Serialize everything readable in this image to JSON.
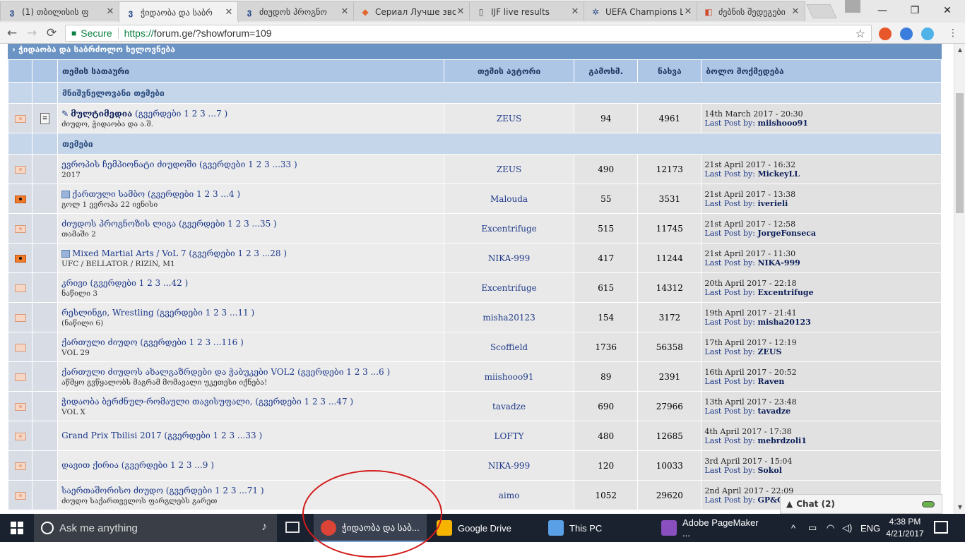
{
  "browser": {
    "tabs": [
      {
        "icon": "ვ",
        "icon_color": "#2b4c8c",
        "title": "(1) თბილისის ფ",
        "close": "✕"
      },
      {
        "icon": "ვ",
        "icon_color": "#2b4c8c",
        "title": "ჭიდაობა და საბრ",
        "close": "✕"
      },
      {
        "icon": "ვ",
        "icon_color": "#2b4c8c",
        "title": "ძიუდოს პროგნო",
        "close": "✕"
      },
      {
        "icon": "◆",
        "icon_color": "#e2672b",
        "title": "Сериал Лучше зво",
        "close": "✕"
      },
      {
        "icon": "▯",
        "icon_color": "#555555",
        "title": "IJF live results",
        "close": "✕"
      },
      {
        "icon": "✲",
        "icon_color": "#2b4c8c",
        "title": "UEFA Champions L",
        "close": "✕"
      },
      {
        "icon": "◧",
        "icon_color": "#d14b2c",
        "title": "ძებნის შედეგები",
        "close": "✕"
      }
    ],
    "window_controls": {
      "minimize": "—",
      "maximize": "❐",
      "close": "✕"
    },
    "nav": {
      "back": "←",
      "forward": "→",
      "reload": "⟳"
    },
    "address": {
      "lock": "🔒",
      "secure_label": "Secure",
      "proto": "https://",
      "rest": "forum.ge/?showforum=109",
      "star": "☆"
    }
  },
  "forum": {
    "heading": "› ჭიდაობა და საბრძოლო ხელოვნება",
    "columns": {
      "title": "თემის სათაური",
      "author": "თემის ავტორი",
      "replies": "გამოხმ.",
      "views": "ნახვა",
      "last": "ბოლო მოქმედება"
    },
    "pinned_section": "მნიშვნელოვანი თემები",
    "topics_section": "თემები",
    "last_post_label": "Last Post by:",
    "pinned": [
      {
        "title": "მულტიმედია",
        "pages": "(გვერდები 1 2 3 ...7 )",
        "desc": "ძიუდო, ჭიდაობა და ა.შ.",
        "author": "ZEUS",
        "replies": "94",
        "views": "4961",
        "date": "14th March 2017 - 20:30",
        "last_by": "miishooo91"
      }
    ],
    "topics": [
      {
        "title": "ევროპის ჩემპიონატი ძიუდოში",
        "pages": "(გვერდები 1 2 3 ...33 )",
        "desc": "2017",
        "author": "ZEUS",
        "replies": "490",
        "views": "12173",
        "date": "21st April 2017 - 16:32",
        "last_by": "MickeyLL",
        "icon": "normal"
      },
      {
        "title": "ქართული სამბო",
        "pages": "(გვერდები 1 2 3 ...4 )",
        "desc": "გოლ 1 ევროპა 22 ივნისი",
        "author": "Malouda",
        "replies": "55",
        "views": "3531",
        "date": "21st April 2017 - 13:38",
        "last_by": "iverieli",
        "icon": "hot"
      },
      {
        "title": "ძიუდოს პროგნოზის ლიგა",
        "pages": "(გვერდები 1 2 3 ...35 )",
        "desc": "თამაში 2",
        "author": "Excentrifuge",
        "replies": "515",
        "views": "11745",
        "date": "21st April 2017 - 12:58",
        "last_by": "JorgeFonseca",
        "icon": "normal"
      },
      {
        "title": "Mixed Martial Arts / VoL 7",
        "pages": "(გვერდები 1 2 3 ...28 )",
        "desc": "UFC / BELLATOR / RIZIN, M1",
        "author": "NIKA-999",
        "replies": "417",
        "views": "11244",
        "date": "21st April 2017 - 11:30",
        "last_by": "NIKA-999",
        "icon": "hot"
      },
      {
        "title": "კრივი",
        "pages": "(გვერდები 1 2 3 ...42 )",
        "desc": "ნაწილი 3",
        "author": "Excentrifuge",
        "replies": "615",
        "views": "14312",
        "date": "20th April 2017 - 22:18",
        "last_by": "Excentrifuge",
        "icon": "plain"
      },
      {
        "title": "რესლინგი, Wrestling",
        "pages": "(გვერდები 1 2 3 ...11 )",
        "desc": "(ნაწილი 6)",
        "author": "misha20123",
        "replies": "154",
        "views": "3172",
        "date": "19th April 2017 - 21:41",
        "last_by": "misha20123",
        "icon": "plain"
      },
      {
        "title": "ქართული ძიუდო",
        "pages": "(გვერდები 1 2 3 ...116 )",
        "desc": "VOL 29",
        "author": "Scoffield",
        "replies": "1736",
        "views": "56358",
        "date": "17th April 2017 - 12:19",
        "last_by": "ZEUS",
        "icon": "plain"
      },
      {
        "title": "ქართული ძიუდოს ახალგაზრდები და ჭაბუკები VOL2",
        "pages": "(გვერდები 1 2 3 ...6 )",
        "desc": "აწმყო გვწყალობს მაგრამ მომავალი უკეთესი იქნება!",
        "author": "miishooo91",
        "replies": "89",
        "views": "2391",
        "date": "16th April 2017 - 20:52",
        "last_by": "Raven",
        "icon": "plain"
      },
      {
        "title": "ჭიდაობა ბერძნულ-რომაული თავისუფალი,",
        "pages": "(გვერდები 1 2 3 ...47 )",
        "desc": "VOL X",
        "author": "tavadze",
        "replies": "690",
        "views": "27966",
        "date": "13th April 2017 - 23:48",
        "last_by": "tavadze",
        "icon": "normal"
      },
      {
        "title": "Grand Prix Tbilisi 2017",
        "pages": "(გვერდები 1 2 3 ...33 )",
        "desc": "",
        "author": "LOFTY",
        "replies": "480",
        "views": "12685",
        "date": "4th April 2017 - 17:38",
        "last_by": "mebrdzoli1",
        "icon": "normal"
      },
      {
        "title": "დავით ქირია",
        "pages": "(გვერდები 1 2 3 ...9 )",
        "desc": "",
        "author": "NIKA-999",
        "replies": "120",
        "views": "10033",
        "date": "3rd April 2017 - 15:04",
        "last_by": "Sokol",
        "icon": "normal"
      },
      {
        "title": "საერთაშორისო ძიუდო",
        "pages": "(გვერდები 1 2 3 ...71 )",
        "desc": "ძიუდო საქართველოს ფარგლებს გარეთ",
        "author": "aimo",
        "replies": "1052",
        "views": "29620",
        "date": "2nd April 2017 - 22:09",
        "last_by": "GP&GI",
        "icon": "normal"
      }
    ]
  },
  "chat": {
    "label": "Chat (2)",
    "icon": "👤"
  },
  "taskbar": {
    "search_placeholder": "Ask me anything",
    "mic": "🎤",
    "apps": [
      {
        "label": "ჭიდაობა და საბ...",
        "color": "#db4437"
      },
      {
        "label": "Google Drive",
        "color": "#f4b400"
      },
      {
        "label": "This PC",
        "color": "#5aa0e6"
      },
      {
        "label": "Adobe PageMaker ...",
        "color": "#8a4fbf"
      }
    ],
    "tray": {
      "caret": "^",
      "lang": "ENG",
      "vol": "🔊"
    },
    "clock": {
      "time": "4:38 PM",
      "date": "4/21/2017"
    }
  }
}
